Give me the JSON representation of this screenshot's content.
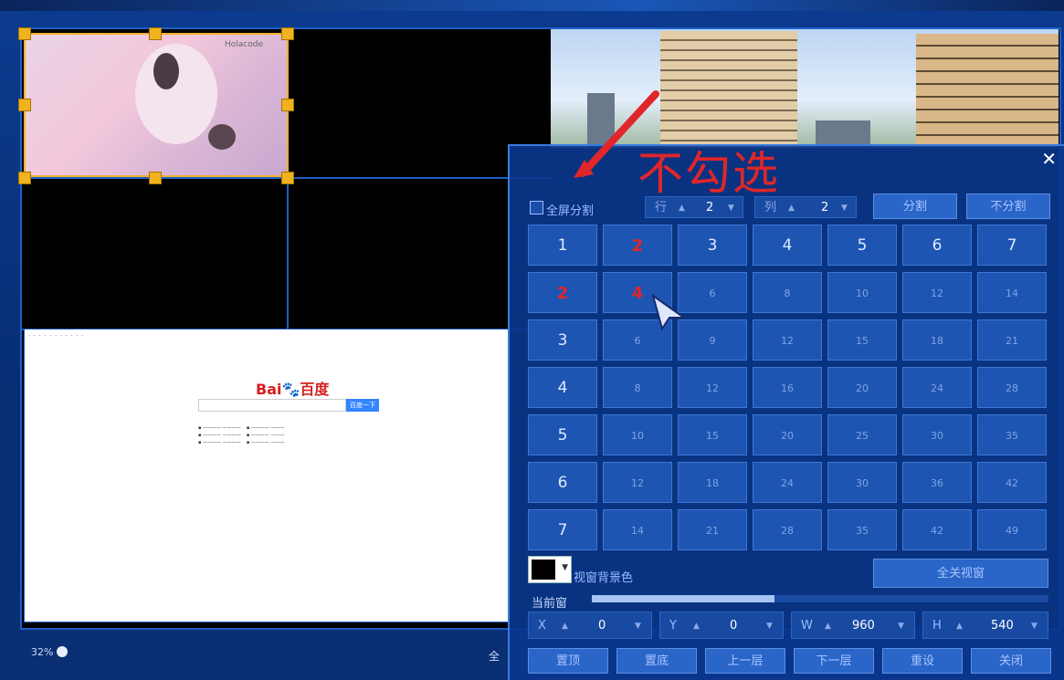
{
  "annotation": {
    "text": "不勾选"
  },
  "panel": {
    "close_label": "✕",
    "fullscreen_split_label": "全屏分割",
    "row_label": "行",
    "row_value": "2",
    "col_label": "列",
    "col_value": "2",
    "split_button": "分割",
    "unsplit_button": "不分割",
    "grid_header_row": [
      "1",
      "2",
      "3",
      "4",
      "5",
      "6",
      "7"
    ],
    "grid_rows": [
      [
        "2",
        "4",
        "6",
        "8",
        "10",
        "12",
        "14"
      ],
      [
        "3",
        "6",
        "9",
        "12",
        "15",
        "18",
        "21"
      ],
      [
        "4",
        "8",
        "12",
        "16",
        "20",
        "24",
        "28"
      ],
      [
        "5",
        "10",
        "15",
        "20",
        "25",
        "30",
        "35"
      ],
      [
        "6",
        "12",
        "18",
        "24",
        "30",
        "36",
        "42"
      ],
      [
        "7",
        "14",
        "21",
        "28",
        "35",
        "42",
        "49"
      ]
    ],
    "bg_color_label": "视窗背景色",
    "close_all_button": "全关视窗",
    "current_window_label": "当前窗",
    "x_label": "X",
    "x_value": "0",
    "y_label": "Y",
    "y_value": "0",
    "w_label": "W",
    "w_value": "960",
    "h_label": "H",
    "h_value": "540",
    "bottom_buttons": [
      "置顶",
      "置底",
      "上一层",
      "下一层",
      "重设",
      "关闭"
    ]
  },
  "browser": {
    "logo": "Bai百度",
    "search_button": "百度一下"
  },
  "window_watermark": "Holacode",
  "zoom_label": "32%",
  "bottom_partial_text": "全"
}
